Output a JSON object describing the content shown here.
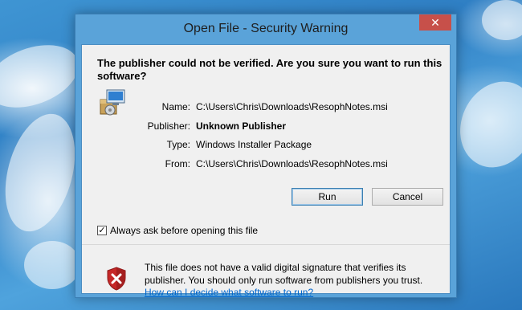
{
  "window": {
    "title": "Open File - Security Warning",
    "close_glyph": "✕"
  },
  "question": "The publisher could not be verified.  Are you sure you want to run this software?",
  "fields": [
    {
      "label": "Name:",
      "value": "C:\\Users\\Chris\\Downloads\\ResophNotes.msi",
      "bold": false
    },
    {
      "label": "Publisher:",
      "value": "Unknown Publisher",
      "bold": true
    },
    {
      "label": "Type:",
      "value": "Windows Installer Package",
      "bold": false
    },
    {
      "label": "From:",
      "value": "C:\\Users\\Chris\\Downloads\\ResophNotes.msi",
      "bold": false
    }
  ],
  "buttons": {
    "run_label": "Run",
    "cancel_label": "Cancel"
  },
  "checkbox": {
    "checked": true,
    "label": "Always ask before opening this file"
  },
  "warning": {
    "text": "This file does not have a valid digital signature that verifies its publisher.  You should only run software from publishers you trust.",
    "link": "How can I decide what software to run?"
  },
  "icons": {
    "installer": "installer-package-icon",
    "shield": "security-shield-error-icon",
    "close": "close-icon"
  },
  "colors": {
    "close_button": "#c7504a",
    "frame": "#5aa3d9",
    "link": "#0066cc"
  }
}
